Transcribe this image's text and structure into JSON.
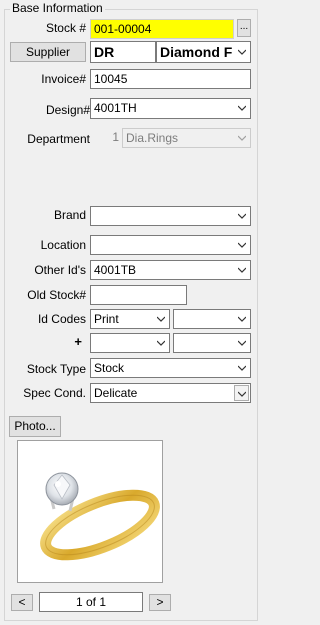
{
  "group_title": "Base Information",
  "stock": {
    "label": "Stock #",
    "value": "001-00004",
    "browse_label": "..."
  },
  "supplier": {
    "button_label": "Supplier",
    "code": "DR",
    "name": "Diamond F"
  },
  "invoice": {
    "label": "Invoice#",
    "value": "10045"
  },
  "design": {
    "label": "Design#",
    "value": "4001TH"
  },
  "department": {
    "label": "Department",
    "number": "1",
    "value": "Dia.Rings"
  },
  "brand": {
    "label": "Brand",
    "value": ""
  },
  "location": {
    "label": "Location",
    "value": ""
  },
  "other_ids": {
    "label": "Other Id's",
    "value": "4001TB"
  },
  "old_stock": {
    "label": "Old Stock#",
    "value": ""
  },
  "id_codes": {
    "label": "Id Codes",
    "value1": "Print",
    "value2": ""
  },
  "plus_row": {
    "label": "+",
    "value1": "",
    "value2": ""
  },
  "stock_type": {
    "label": "Stock Type",
    "value": "Stock"
  },
  "spec_cond": {
    "label": "Spec Cond.",
    "value": "Delicate"
  },
  "photo": {
    "button_label": "Photo...",
    "image_icon": "gold-solitaire-ring"
  },
  "pager": {
    "prev_label": "<",
    "page_text": "1 of 1",
    "next_label": ">"
  },
  "colors": {
    "stock_highlight": "#ffff00",
    "window_bg": "#f0f0f0"
  }
}
